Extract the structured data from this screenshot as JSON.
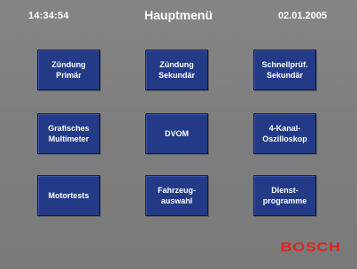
{
  "header": {
    "time": "14:34:54",
    "title": "Hauptmenü",
    "date": "02.01.2005"
  },
  "menu": {
    "buttons": [
      {
        "label": "Zündung\nPrimär"
      },
      {
        "label": "Zündung\nSekundär"
      },
      {
        "label": "Schnellprüf.\nSekundär"
      },
      {
        "label": "Grafisches\nMultimeter"
      },
      {
        "label": "DVOM"
      },
      {
        "label": "4-Kanal-\nOszilloskop"
      },
      {
        "label": "Motortests"
      },
      {
        "label": "Fahrzeug-\nauswahl"
      },
      {
        "label": "Dienst-\nprogramme"
      }
    ]
  },
  "brand": {
    "logo_text": "BOSCH",
    "logo_color": "#e2231a"
  },
  "colors": {
    "background": "#7f7f7f",
    "button": "#233a86",
    "text": "#ffffff"
  }
}
